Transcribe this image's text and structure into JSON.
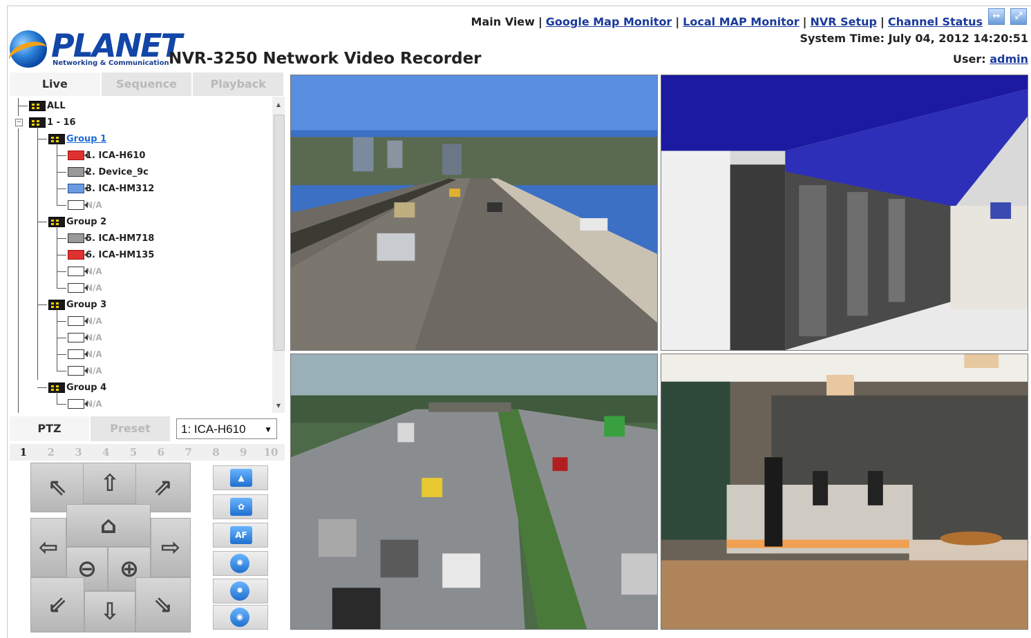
{
  "header": {
    "logo_text": "PLANET",
    "logo_sub": "Networking & Communication",
    "title": "NVR-3250 Network Video Recorder",
    "nav": {
      "main_view": "Main View",
      "google_map": "Google Map Monitor",
      "local_map": "Local MAP Monitor",
      "nvr_setup": "NVR Setup",
      "channel_status": "Channel Status",
      "separator": "|"
    },
    "system_time_label": "System Time:",
    "system_time": "July 04, 2012 14:20:51",
    "user_label": "User:",
    "user": "admin"
  },
  "tabs": [
    "Live",
    "Sequence",
    "Playback"
  ],
  "tree": {
    "all": "ALL",
    "range": "1 - 16",
    "expander": "−",
    "groups": [
      {
        "label": "Group 1",
        "items": [
          {
            "label": "1. ICA-H610",
            "state": "red"
          },
          {
            "label": "2. Device_9c",
            "state": "gray"
          },
          {
            "label": "3. ICA-HM312",
            "state": "blue"
          },
          {
            "label": "N/A",
            "state": "none"
          }
        ]
      },
      {
        "label": "Group 2",
        "items": [
          {
            "label": "5. ICA-HM718",
            "state": "gray"
          },
          {
            "label": "6. ICA-HM135",
            "state": "red"
          },
          {
            "label": "N/A",
            "state": "none"
          },
          {
            "label": "N/A",
            "state": "none"
          }
        ]
      },
      {
        "label": "Group 3",
        "items": [
          {
            "label": "N/A",
            "state": "none"
          },
          {
            "label": "N/A",
            "state": "none"
          },
          {
            "label": "N/A",
            "state": "none"
          },
          {
            "label": "N/A",
            "state": "none"
          }
        ]
      },
      {
        "label": "Group 4",
        "items": [
          {
            "label": "N/A",
            "state": "none"
          }
        ]
      }
    ]
  },
  "ptz": {
    "tabs": [
      "PTZ",
      "Preset"
    ],
    "selected_camera": "1: ICA-H610",
    "presets": [
      "1",
      "2",
      "3",
      "4",
      "5",
      "6",
      "7",
      "8",
      "9",
      "10"
    ],
    "active_preset": "1",
    "side_af_label": "AF"
  },
  "glyphs": {
    "up_left": "⇖",
    "up": "⇧",
    "up_right": "⇗",
    "left": "⇦",
    "home": "⌂",
    "right": "⇨",
    "zoom_out": "⊖",
    "zoom_in": "⊕",
    "down_left": "⇙",
    "down": "⇩",
    "down_right": "⇘",
    "dropdown": "▼",
    "scroll_up": "▲",
    "scroll_down": "▼",
    "win1": "↔",
    "win2": "⤢"
  },
  "icons": [
    "search-icon"
  ]
}
